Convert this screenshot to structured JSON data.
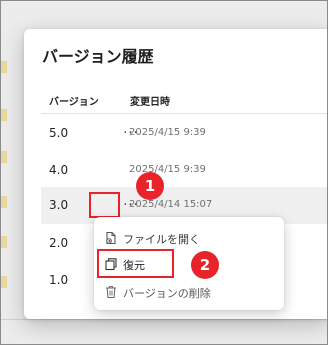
{
  "dialog": {
    "title": "バージョン履歴",
    "columns": {
      "version": "バージョン",
      "date": "変更日時"
    }
  },
  "rows": [
    {
      "version": "5.0",
      "more": "...",
      "date": "2025/4/15 9:39"
    },
    {
      "version": "4.0",
      "date": "2025/4/15 9:39"
    },
    {
      "version": "3.0",
      "more": "...",
      "date": "2025/4/14 15:07"
    },
    {
      "version": "2.0"
    },
    {
      "version": "1.0"
    }
  ],
  "context_menu": {
    "items": [
      {
        "label": "ファイルを開く",
        "icon": "open-file-icon"
      },
      {
        "label": "復元",
        "icon": "restore-icon"
      },
      {
        "label": "バージョンの削除",
        "icon": "trash-icon"
      }
    ]
  },
  "callouts": [
    "1",
    "2"
  ],
  "colors": {
    "accent": "#e8232a",
    "selected_row": "#f0f0f0"
  }
}
